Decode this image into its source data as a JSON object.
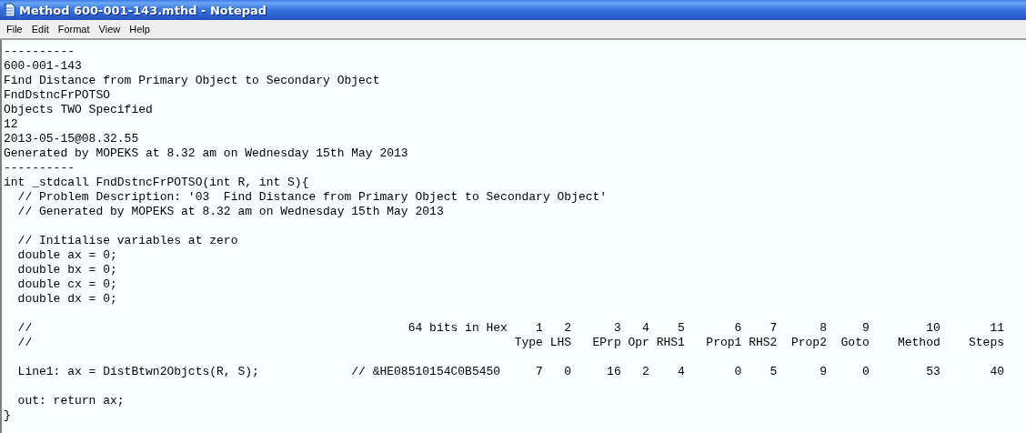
{
  "window": {
    "title": "Method 600-001-143.mthd - Notepad"
  },
  "menu": [
    {
      "label": "File"
    },
    {
      "label": "Edit"
    },
    {
      "label": "Format"
    },
    {
      "label": "View"
    },
    {
      "label": "Help"
    }
  ],
  "lines": [
    {
      "kind": "text",
      "text": "----------"
    },
    {
      "kind": "text",
      "text": "600-001-143"
    },
    {
      "kind": "text",
      "text": "Find Distance from Primary Object to Secondary Object"
    },
    {
      "kind": "text",
      "text": "FndDstncFrPOTSO"
    },
    {
      "kind": "text",
      "text": "Objects TWO Specified"
    },
    {
      "kind": "text",
      "text": "12"
    },
    {
      "kind": "text",
      "text": "2013-05-15@08.32.55"
    },
    {
      "kind": "text",
      "text": "Generated by MOPEKS at 8.32 am on Wednesday 15th May 2013"
    },
    {
      "kind": "text",
      "text": "----------"
    },
    {
      "kind": "text",
      "text": "int _stdcall FndDstncFrPOTSO(int R, int S){"
    },
    {
      "kind": "text",
      "text": "  // Problem Description: '03  Find Distance from Primary Object to Secondary Object'"
    },
    {
      "kind": "text",
      "text": "  // Generated by MOPEKS at 8.32 am on Wednesday 15th May 2013"
    },
    {
      "kind": "blank"
    },
    {
      "kind": "text",
      "text": "  // Initialise variables at zero"
    },
    {
      "kind": "text",
      "text": "  double ax = 0;"
    },
    {
      "kind": "text",
      "text": "  double bx = 0;"
    },
    {
      "kind": "text",
      "text": "  double cx = 0;"
    },
    {
      "kind": "text",
      "text": "  double dx = 0;"
    },
    {
      "kind": "blank"
    },
    {
      "kind": "text",
      "text": "  //                                                     64 bits in Hex    1   2      3   4    5       6    7      8     9        10       11"
    },
    {
      "kind": "text",
      "text": "  //                                                                    Type LHS   EPrp Opr RHS1   Prop1 RHS2  Prop2  Goto    Method    Steps"
    },
    {
      "kind": "blank"
    },
    {
      "kind": "text",
      "text": "  Line1: ax = DistBtwn2Objcts(R, S);             // &HE08510154C0B5450     7   0     16   2    4       0    5      9     0        53       40"
    },
    {
      "kind": "blank"
    },
    {
      "kind": "text",
      "text": "  out: return ax;"
    },
    {
      "kind": "text",
      "text": "}"
    }
  ]
}
